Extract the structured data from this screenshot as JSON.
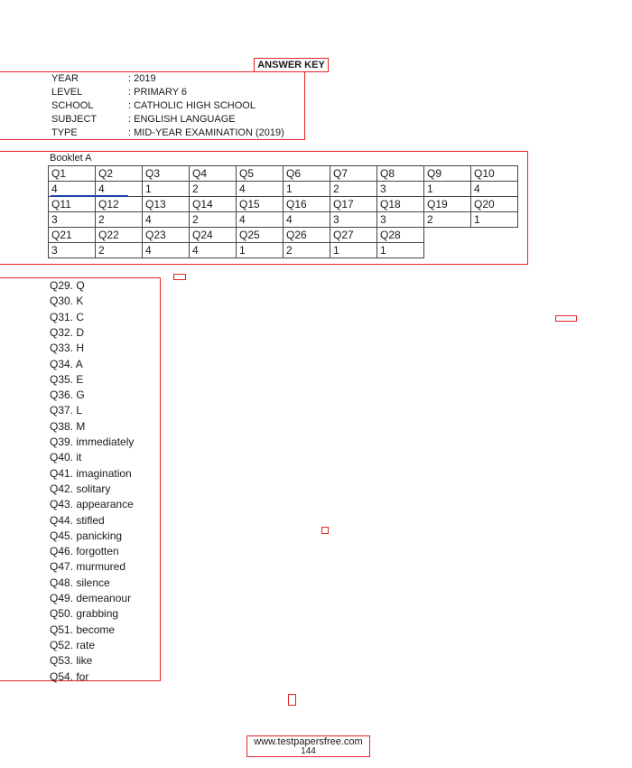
{
  "title": "ANSWER KEY",
  "info": [
    {
      "label": "YEAR",
      "value": ": 2019"
    },
    {
      "label": "LEVEL",
      "value": ": PRIMARY 6"
    },
    {
      "label": "SCHOOL",
      "value": ": CATHOLIC HIGH SCHOOL"
    },
    {
      "label": "SUBJECT",
      "value": ": ENGLISH LANGUAGE"
    },
    {
      "label": "TYPE",
      "value": ": MID-YEAR EXAMINATION (2019)"
    }
  ],
  "booklet_a": {
    "title": "Booklet A",
    "rows": [
      {
        "questions": [
          "Q1",
          "Q2",
          "Q3",
          "Q4",
          "Q5",
          "Q6",
          "Q7",
          "Q8",
          "Q9",
          "Q10"
        ],
        "answers": [
          "4",
          "4",
          "1",
          "2",
          "4",
          "1",
          "2",
          "3",
          "1",
          "4"
        ]
      },
      {
        "questions": [
          "Q11",
          "Q12",
          "Q13",
          "Q14",
          "Q15",
          "Q16",
          "Q17",
          "Q18",
          "Q19",
          "Q20"
        ],
        "answers": [
          "3",
          "2",
          "4",
          "2",
          "4",
          "4",
          "3",
          "3",
          "2",
          "1"
        ]
      },
      {
        "questions": [
          "Q21",
          "Q22",
          "Q23",
          "Q24",
          "Q25",
          "Q26",
          "Q27",
          "Q28"
        ],
        "answers": [
          "3",
          "2",
          "4",
          "4",
          "1",
          "2",
          "1",
          "1"
        ]
      }
    ]
  },
  "booklet_b": [
    "Q29. Q",
    "Q30. K",
    "Q31. C",
    "Q32. D",
    "Q33. H",
    "Q34. A",
    "Q35. E",
    "Q36. G",
    "Q37. L",
    "Q38. M",
    "Q39. immediately",
    "Q40. it",
    "Q41. imagination",
    "Q42. solitary",
    "Q43. appearance",
    "Q44. stifled",
    "Q45. panicking",
    "Q46. forgotten",
    "Q47. murmured",
    "Q48. silence",
    "Q49. demeanour",
    "Q50. grabbing",
    "Q51. become",
    "Q52. rate",
    "Q53. like",
    "Q54. for"
  ],
  "footer": {
    "url": "www.testpapersfree.com",
    "page": "144"
  }
}
